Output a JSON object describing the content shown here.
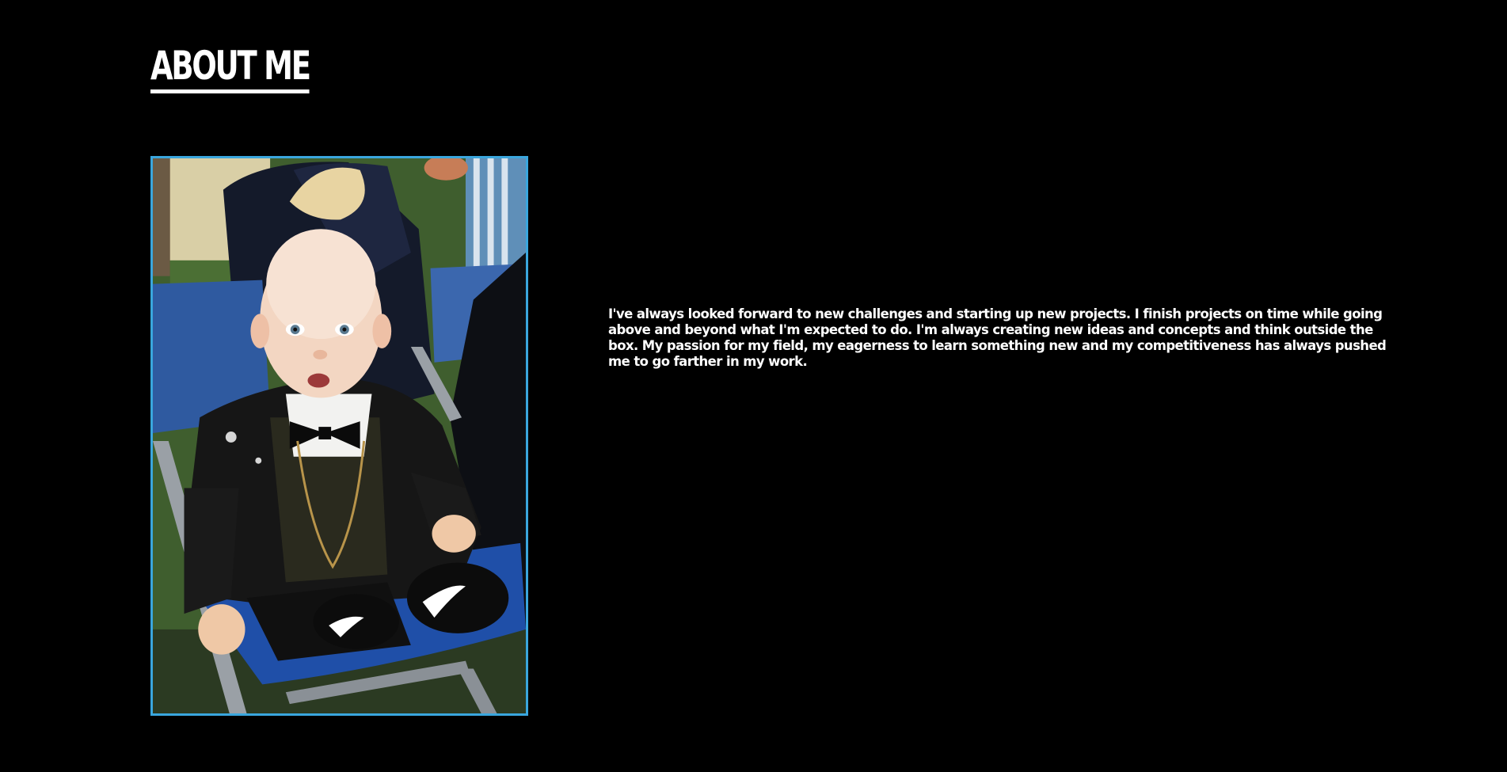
{
  "page": {
    "title": "ABOUT ME",
    "bio": "I've always looked forward to new challenges and starting up new projects. I finish projects on time while going above and beyond what I'm expected to do. I'm always creating new ideas and concepts and think outside the box. My passion for my field, my eagerness to learn something new and my competitiveness has always pushed me to go farther in my work."
  },
  "photo": {
    "border_color": "#3aa6dd"
  },
  "colors": {
    "background": "#000000",
    "text": "#ffffff",
    "accent": "#3aa6dd"
  }
}
